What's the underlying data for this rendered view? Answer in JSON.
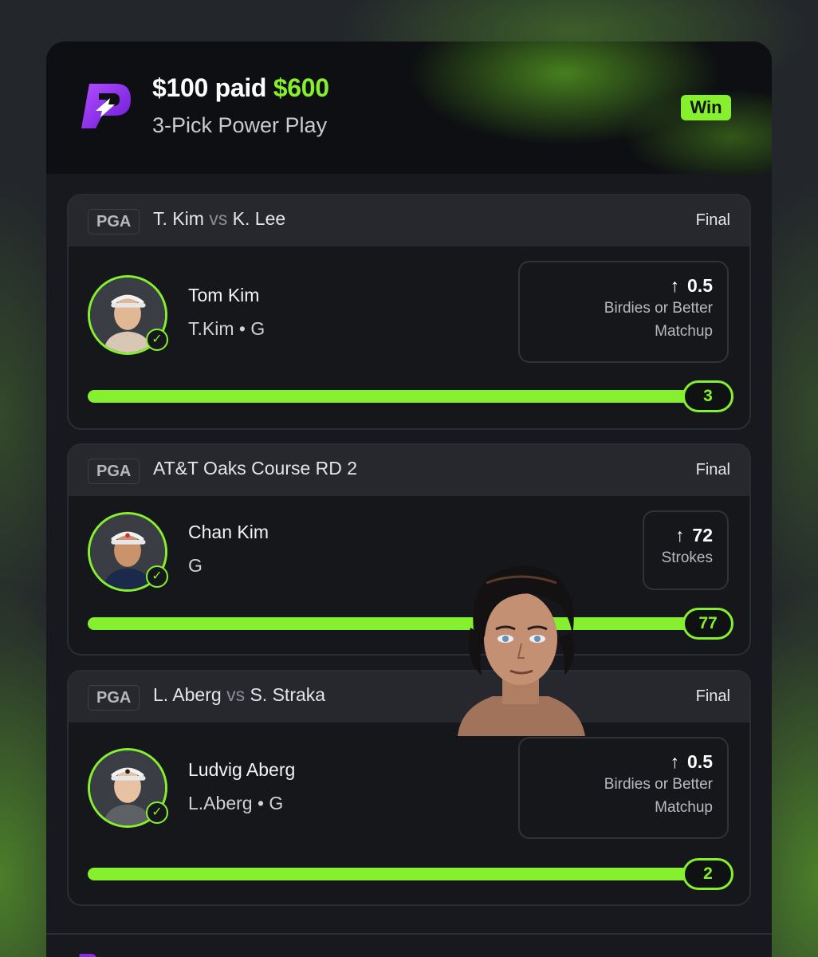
{
  "header": {
    "stake": "$100 paid",
    "payout": "$600",
    "play_type": "3-Pick Power Play",
    "result_badge": "Win"
  },
  "picks": [
    {
      "league": "PGA",
      "match_a": "T. Kim",
      "vs": "vs",
      "match_b": "K. Lee",
      "status": "Final",
      "player_name": "Tom Kim",
      "player_sub": "T.Kim • G",
      "line": "0.5",
      "stat_line1": "Birdies or Better",
      "stat_line2": "Matchup",
      "result": "3",
      "progress_pct": 100
    },
    {
      "league": "PGA",
      "event": "AT&T Oaks Course RD 2",
      "status": "Final",
      "player_name": "Chan Kim",
      "player_sub": "G",
      "line": "72",
      "stat_line1": "Strokes",
      "result": "77",
      "progress_pct": 100
    },
    {
      "league": "PGA",
      "match_a": "L. Aberg",
      "vs": "vs",
      "match_b": "S. Straka",
      "status": "Final",
      "player_name": "Ludvig Aberg",
      "player_sub": "L.Aberg • G",
      "line": "0.5",
      "stat_line1": "Birdies or Better",
      "stat_line2": "Matchup",
      "result": "2",
      "progress_pct": 100
    }
  ],
  "icons": {
    "brand": "prizepicks-logo-icon",
    "check": "checkmark-icon",
    "arrow": "arrow-up-icon"
  },
  "colors": {
    "accent": "#86f02e",
    "card_bg": "#18191e",
    "brand_purple": "#8a2be2"
  }
}
